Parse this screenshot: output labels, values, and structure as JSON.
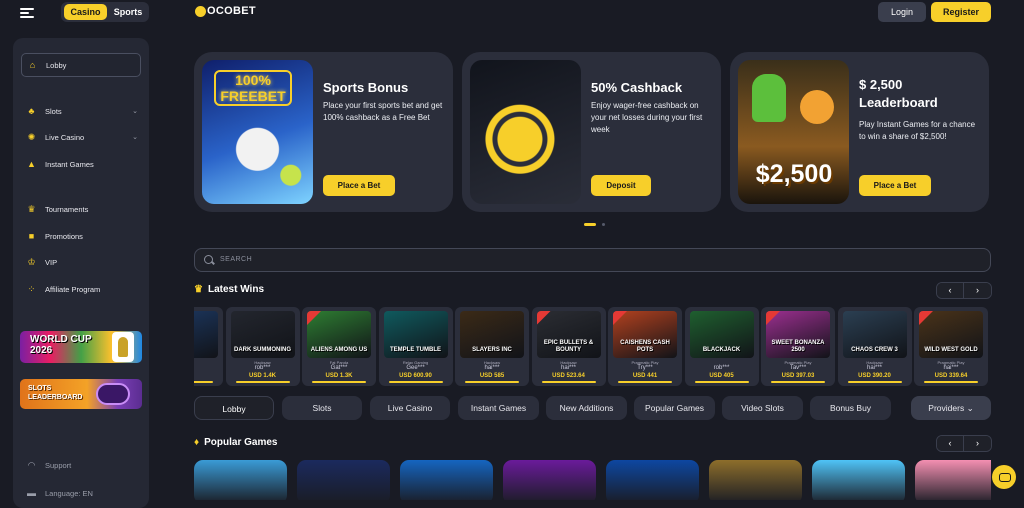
{
  "header": {
    "tabs": [
      "Casino",
      "Sports"
    ],
    "logo": "OCOBET",
    "login_label": "Login",
    "register_label": "Register",
    "accent_color": "#f7cf2a"
  },
  "sidebar": {
    "items": [
      {
        "label": "Lobby",
        "icon": "home-icon"
      },
      {
        "label": "Slots",
        "icon": "cherry-icon"
      },
      {
        "label": "Live Casino",
        "icon": "chip-icon"
      },
      {
        "label": "Instant Games",
        "icon": "rocket-icon"
      },
      {
        "label": "Tournaments",
        "icon": "trophy-icon"
      },
      {
        "label": "Promotions",
        "icon": "gift-icon"
      },
      {
        "label": "VIP",
        "icon": "crown-icon"
      },
      {
        "label": "Affiliate Program",
        "icon": "users-icon"
      },
      {
        "label": "Support",
        "icon": "headset-icon"
      },
      {
        "label": "Language: EN",
        "icon": "flag-icon"
      }
    ],
    "promo_worldcup": "WORLD CUP\n2026",
    "promo_slots": "SLOTS\nLEADERBOARD"
  },
  "promos": [
    {
      "title": "Sports Bonus",
      "text": "Place your first sports bet and get 100% cashback as a Free Bet",
      "cta": "Place a Bet",
      "art_label": "100%\nFREEBET"
    },
    {
      "title": "50% Cashback",
      "text": "Enjoy wager-free cashback on your net losses during your first week",
      "cta": "Deposit"
    },
    {
      "title": "$ 2,500 Leaderboard",
      "text": "Play Instant Games for a chance to win a share of $2,500!",
      "cta": "Place a Bet",
      "art_label": "$2,500"
    }
  ],
  "search": {
    "placeholder": "SEARCH"
  },
  "latest_wins": {
    "title": "Latest Wins",
    "items": [
      {
        "game": "SE",
        "provider": "",
        "user": "",
        "amount": ""
      },
      {
        "game": "DARK SUMMONING",
        "provider": "Hacksaw",
        "user": "rob***",
        "amount": "USD 1.4K"
      },
      {
        "game": "ALIENS AMONG US",
        "provider": "Fat Panda",
        "user": "Gat***",
        "amount": "USD 1.3K",
        "new": true
      },
      {
        "game": "TEMPLE TUMBLE",
        "provider": "Relax Gaming",
        "user": "Gee***",
        "amount": "USD 600.90"
      },
      {
        "game": "SLAYERS INC",
        "provider": "Hacksaw",
        "user": "hai***",
        "amount": "USD 585"
      },
      {
        "game": "EPIC BULLETS & BOUNTY",
        "provider": "Hacksaw",
        "user": "hai***",
        "amount": "USD 523.64",
        "new": true
      },
      {
        "game": "CAISHENS CASH POTS",
        "provider": "Pragmatic Play",
        "user": "Try***",
        "amount": "USD 441",
        "new": true
      },
      {
        "game": "BLACKJACK",
        "provider": "",
        "user": "rob***",
        "amount": "USD 405"
      },
      {
        "game": "SWEET BONANZA 2500",
        "provider": "Pragmatic Play",
        "user": "Tav***",
        "amount": "USD 397.03",
        "new": true
      },
      {
        "game": "CHAOS CREW 3",
        "provider": "Hacksaw",
        "user": "hai***",
        "amount": "USD 390.20"
      },
      {
        "game": "WILD WEST GOLD",
        "provider": "Pragmatic Play",
        "user": "hai***",
        "amount": "USD 339.64",
        "new": true
      }
    ]
  },
  "categories": [
    "Lobby",
    "Slots",
    "Live Casino",
    "Instant Games",
    "New Additions",
    "Popular Games",
    "Video Slots",
    "Bonus Buy",
    "Providers"
  ],
  "popular_games": {
    "title": "Popular Games"
  }
}
